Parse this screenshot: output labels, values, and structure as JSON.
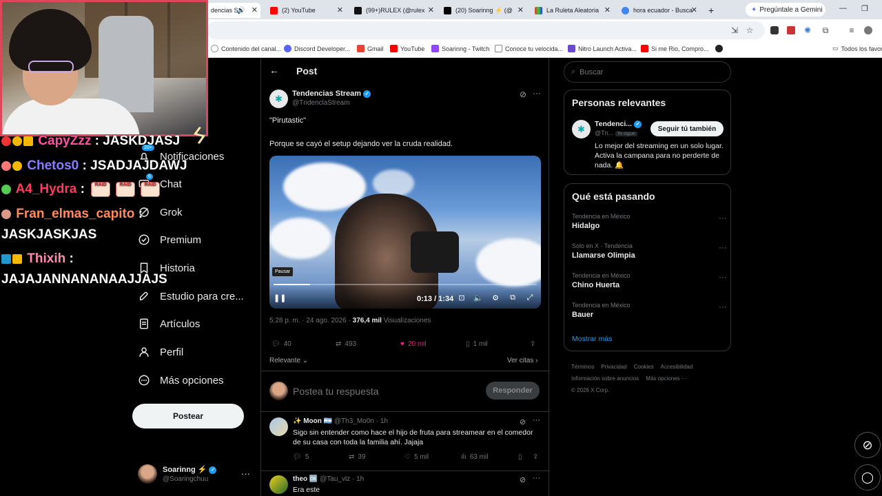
{
  "browser": {
    "tabs": [
      {
        "label": "dencias S",
        "active": true
      },
      {
        "label": "(2) YouTube"
      },
      {
        "label": "(99+)RULEX (@rulex"
      },
      {
        "label": "(20) Soarinng ⚡ (@"
      },
      {
        "label": "La Ruleta Aleatoria"
      },
      {
        "label": "hora ecuador - Busca"
      }
    ],
    "new_tab": "+",
    "gemini_label": "Pregúntale a Gemini",
    "bookmarks": [
      "Contenido del canal...",
      "Discord Developer...",
      "Gmail",
      "YouTube",
      "Soarinng - Twitch",
      "Conoce tu velocida...",
      "Nitro Launch Activa...",
      "Si me Rio, Compro..."
    ],
    "all_bookmarks": "Todos los favor"
  },
  "chat": [
    {
      "user": "CapyZzz",
      "sep": " : ",
      "msg": "JASKDJASJ",
      "color": "#ff4fa3"
    },
    {
      "user": "Chetos0",
      "sep": " : ",
      "msg": "JSADJAJDAWJ",
      "color": "#8a7cff"
    },
    {
      "user": "A4_Hydra",
      "sep": " : ",
      "msg": "",
      "color": "#ff3b5c"
    },
    {
      "user": "Fran_elmas_capito",
      "sep": " :",
      "msg": "",
      "color": "#ff8a5c"
    },
    {
      "msg": "JASKJASKJAS"
    },
    {
      "user": "Thixih",
      "sep": " :",
      "msg": "",
      "color": "#ff8ab0"
    },
    {
      "msg": "JAJAJANNANANAAJJAJS"
    }
  ],
  "emote_text": "RAID",
  "notif_badge": "20+",
  "chat_badge": "6",
  "nav": [
    "Notificaciones",
    "Chat",
    "Grok",
    "Premium",
    "Historia",
    "Estudio para cre...",
    "Artículos",
    "Perfil",
    "Más opciones"
  ],
  "post_button": "Postear",
  "account": {
    "name": "Soarinng ⚡",
    "handle": "@Soaringchuu",
    "more": "···"
  },
  "post": {
    "header": "Post",
    "author": "Tendencias Stream",
    "handle": "@TndenclaStream",
    "text1": "\"Pirutastic\"",
    "text2": "Porque se cayó el setup dejando ver la cruda realidad.",
    "video_time": "0:13 / 1:34",
    "video_progress": 0.14,
    "pause_label": "Pausar",
    "date": "5:28 p. m. · 24 ago. 2026 · ",
    "views_count": "376,4 mil",
    "views_label": " Visualizaciones",
    "replies": "40",
    "reposts": "493",
    "likes": "20 mil",
    "bookmarks": "1 mil",
    "sort": "Relevante",
    "quotes": "Ver citas"
  },
  "reply_box": {
    "placeholder": "Postea tu respuesta",
    "button": "Responder"
  },
  "comments": [
    {
      "name": "✨ Moon 🇦🇷",
      "handle": "@Th3_Mo0n · 1h",
      "text": "Sigo sin entender como hace el hijo de fruta para streamear en el comedor de su casa con toda la familia ahí. Jajaja",
      "replies": "5",
      "reposts": "39",
      "likes": "5 mil",
      "views": "63 mil"
    },
    {
      "name": "theo 🆗",
      "handle": "@Tau_vlz · 1h",
      "text": "Era este"
    }
  ],
  "search_placeholder": "Buscar",
  "relevant": {
    "title": "Personas relevantes",
    "name": "Tendenci...",
    "handle": "@Tn...",
    "follows_you": "Te sigue",
    "follow_button": "Seguir tú también",
    "bio": "Lo mejor del streaming en un solo lugar. Activa la campana para no perderte de nada. 🔔"
  },
  "trends": {
    "title": "Qué está pasando",
    "items": [
      {
        "ctx": "Tendencia en México",
        "name": "Hidalgo"
      },
      {
        "ctx": "Solo en X · Tendencia",
        "name": "Llamarse Olimpia"
      },
      {
        "ctx": "Tendencia en México",
        "name": "Chino Huerta"
      },
      {
        "ctx": "Tendencia en México",
        "name": "Bauer"
      }
    ],
    "more": "Mostrar más"
  },
  "footer": [
    "Términos",
    "Privacidad",
    "Cookies",
    "Accesibilidad",
    "Información sobre anuncios",
    "Más opciones ···",
    "© 2026 X Corp."
  ],
  "colors": {
    "accent": "#1d9bf0",
    "like": "#f91880",
    "cam_border": "#e0465a"
  }
}
